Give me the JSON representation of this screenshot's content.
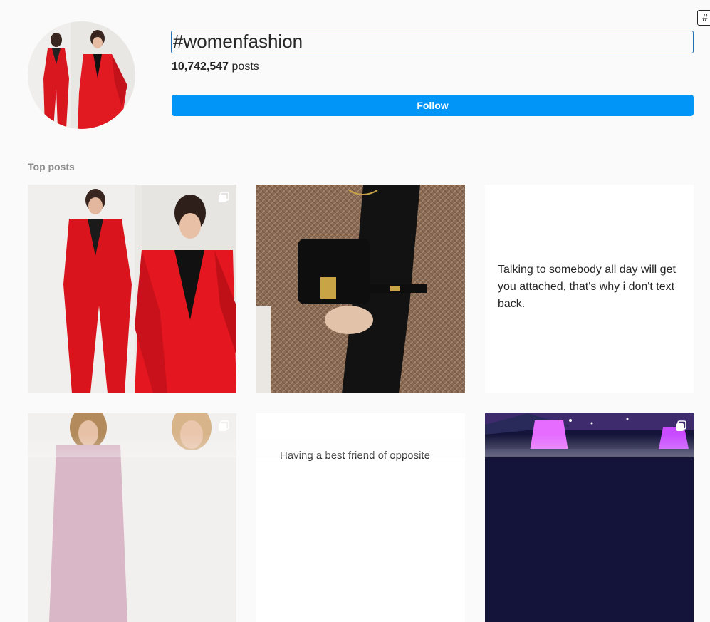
{
  "header": {
    "hashtag": "#womenfashion",
    "post_count": "10,742,547",
    "post_count_label": "posts",
    "follow_label": "Follow",
    "corner_badge": "#"
  },
  "section": {
    "top_posts_label": "Top posts"
  },
  "posts": [
    {
      "kind": "image",
      "subject": "Woman in red suit",
      "multi": true
    },
    {
      "kind": "image",
      "subject": "Brown tweed coat with black bag",
      "multi": false
    },
    {
      "kind": "text",
      "text": "Talking to somebody all day will get you attached, that's why i don't text back.",
      "multi": false
    },
    {
      "kind": "image",
      "subject": "Women in pink blazers",
      "multi": true
    },
    {
      "kind": "text",
      "text": "Having a best friend of opposite",
      "multi": false
    },
    {
      "kind": "image",
      "subject": "Purple lit lamps at night",
      "multi": true
    }
  ],
  "colors": {
    "follow_button": "#0095f6",
    "background": "#fafafa",
    "title_focus_border": "#1f6fb5"
  },
  "icons": {
    "multi_post": "carousel-icon",
    "corner": "hashtag-icon"
  }
}
